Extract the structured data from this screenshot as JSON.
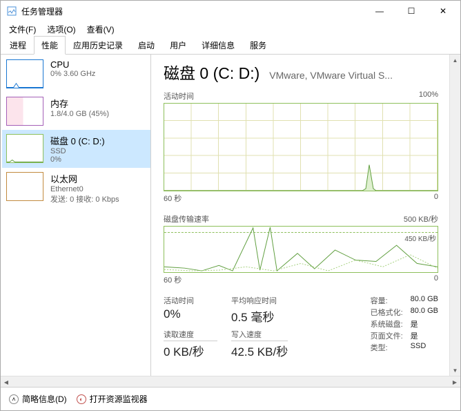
{
  "window": {
    "title": "任务管理器",
    "minimize": "—",
    "maximize": "☐",
    "close": "✕"
  },
  "menu": [
    {
      "label": "文件(F)"
    },
    {
      "label": "选项(O)"
    },
    {
      "label": "查看(V)"
    }
  ],
  "tabs": [
    {
      "label": "进程",
      "active": false
    },
    {
      "label": "性能",
      "active": true
    },
    {
      "label": "应用历史记录",
      "active": false
    },
    {
      "label": "启动",
      "active": false
    },
    {
      "label": "用户",
      "active": false
    },
    {
      "label": "详细信息",
      "active": false
    },
    {
      "label": "服务",
      "active": false
    }
  ],
  "sidebar": [
    {
      "title": "CPU",
      "sub1": "0% 3.60 GHz",
      "sub2": "",
      "type": "cpu"
    },
    {
      "title": "内存",
      "sub1": "1.8/4.0 GB (45%)",
      "sub2": "",
      "type": "mem"
    },
    {
      "title": "磁盘 0 (C: D:)",
      "sub1": "SSD",
      "sub2": "0%",
      "type": "disk",
      "selected": true
    },
    {
      "title": "以太网",
      "sub1": "Ethernet0",
      "sub2": "发送: 0 接收: 0 Kbps",
      "type": "net"
    }
  ],
  "main": {
    "title": "磁盘 0 (C: D:)",
    "subtitle": "VMware, VMware Virtual S...",
    "chart1": {
      "label_left": "活动时间",
      "label_right": "100%",
      "axis_left": "60 秒",
      "axis_right": "0"
    },
    "chart2": {
      "label_left": "磁盘传输速率",
      "label_right": "500 KB/秒",
      "dashed_label": "450 KB/秒",
      "axis_left": "60 秒",
      "axis_right": "0"
    },
    "stats": {
      "active_time_label": "活动时间",
      "active_time": "0%",
      "avg_response_label": "平均响应时间",
      "avg_response": "0.5 毫秒",
      "read_speed_label": "读取速度",
      "read_speed": "0 KB/秒",
      "write_speed_label": "写入速度",
      "write_speed": "42.5 KB/秒"
    },
    "props": [
      {
        "key": "容量:",
        "val": "80.0 GB"
      },
      {
        "key": "已格式化:",
        "val": "80.0 GB"
      },
      {
        "key": "系统磁盘:",
        "val": "是"
      },
      {
        "key": "页面文件:",
        "val": "是"
      },
      {
        "key": "类型:",
        "val": "SSD"
      }
    ]
  },
  "footer": {
    "fewer": "简略信息(D)",
    "resmon": "打开资源监视器"
  },
  "chart_data": [
    {
      "type": "area",
      "title": "活动时间",
      "ylabel": "活动时间 (%)",
      "xlabel": "秒",
      "ylim": [
        0,
        100
      ],
      "xlim_label": "60 秒",
      "x": [
        0,
        2,
        4,
        6,
        8,
        10,
        12,
        14,
        16,
        18,
        20,
        22,
        24,
        26,
        28,
        30,
        32,
        34,
        36,
        38,
        40,
        42,
        44,
        46,
        48,
        50,
        52,
        54,
        56,
        58,
        60
      ],
      "values": [
        0,
        0,
        0,
        0,
        0,
        0,
        0,
        0,
        0,
        0,
        0,
        0,
        0,
        0,
        0,
        0,
        0,
        0,
        0,
        0,
        0,
        0,
        0,
        30,
        0,
        0,
        0,
        0,
        0,
        0,
        0
      ]
    },
    {
      "type": "line",
      "title": "磁盘传输速率",
      "ylabel": "KB/秒",
      "xlabel": "秒",
      "ylim": [
        0,
        500
      ],
      "threshold": 450,
      "xlim_label": "60 秒",
      "series": [
        {
          "name": "读取",
          "x": [
            0,
            5,
            10,
            15,
            20,
            22,
            25,
            28,
            30,
            35,
            40,
            45,
            50,
            55,
            60
          ],
          "values": [
            50,
            30,
            10,
            50,
            10,
            480,
            20,
            490,
            10,
            200,
            30,
            250,
            150,
            300,
            50
          ]
        },
        {
          "name": "写入",
          "x": [
            0,
            5,
            10,
            15,
            20,
            25,
            30,
            35,
            40,
            45,
            50,
            55,
            60
          ],
          "values": [
            20,
            10,
            5,
            30,
            5,
            10,
            5,
            80,
            10,
            120,
            60,
            180,
            30
          ]
        }
      ]
    }
  ]
}
